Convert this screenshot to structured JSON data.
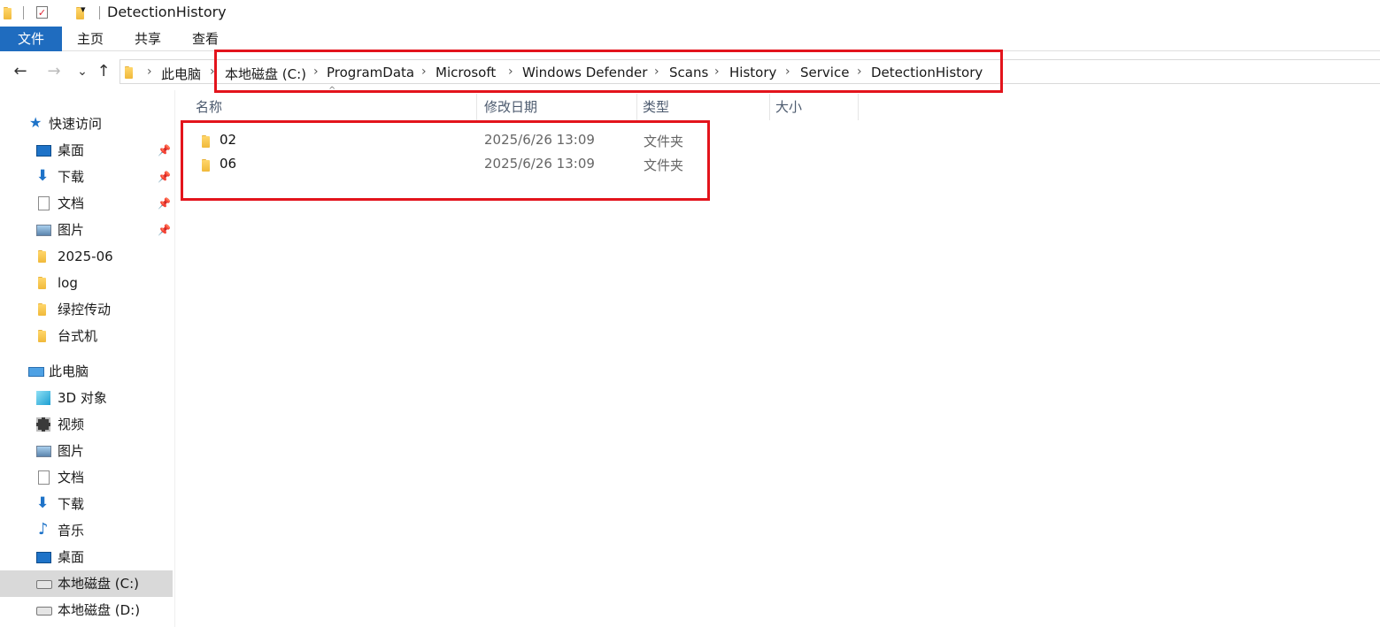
{
  "window": {
    "title": "DetectionHistory"
  },
  "ribbon": {
    "tabs": [
      "文件",
      "主页",
      "共享",
      "查看"
    ]
  },
  "nav": {
    "back": "←",
    "forward": "→",
    "recent": "⌄",
    "up": "↑"
  },
  "breadcrumb": [
    "此电脑",
    "本地磁盘 (C:)",
    "ProgramData",
    "Microsoft",
    "Windows Defender",
    "Scans",
    "History",
    "Service",
    "DetectionHistory"
  ],
  "sidebar": {
    "quick_access": "快速访问",
    "quick_items": [
      {
        "label": "桌面",
        "icon": "desktop-icon",
        "pinned": true
      },
      {
        "label": "下载",
        "icon": "download-icon",
        "pinned": true
      },
      {
        "label": "文档",
        "icon": "document-icon",
        "pinned": true
      },
      {
        "label": "图片",
        "icon": "picture-icon",
        "pinned": true
      },
      {
        "label": "2025-06",
        "icon": "folder-icon",
        "pinned": false
      },
      {
        "label": "log",
        "icon": "folder-icon",
        "pinned": false
      },
      {
        "label": "绿控传动",
        "icon": "folder-icon",
        "pinned": false
      },
      {
        "label": "台式机",
        "icon": "folder-icon",
        "pinned": false
      }
    ],
    "this_pc": "此电脑",
    "pc_items": [
      {
        "label": "3D 对象",
        "icon": "3d-objects-icon"
      },
      {
        "label": "视频",
        "icon": "video-icon"
      },
      {
        "label": "图片",
        "icon": "picture-icon"
      },
      {
        "label": "文档",
        "icon": "document-icon"
      },
      {
        "label": "下载",
        "icon": "download-icon"
      },
      {
        "label": "音乐",
        "icon": "music-icon"
      },
      {
        "label": "桌面",
        "icon": "desktop-icon"
      },
      {
        "label": "本地磁盘 (C:)",
        "icon": "drive-c-icon",
        "selected": true
      },
      {
        "label": "本地磁盘 (D:)",
        "icon": "drive-d-icon"
      }
    ]
  },
  "columns": [
    "名称",
    "修改日期",
    "类型",
    "大小"
  ],
  "files": [
    {
      "name": "02",
      "date": "2025/6/26 13:09",
      "type": "文件夹",
      "icon": "folder-icon"
    },
    {
      "name": "06",
      "date": "2025/6/26 13:09",
      "type": "文件夹",
      "icon": "folder-icon"
    }
  ],
  "colors": {
    "file_tab": "#1f6cbf",
    "highlight": "#e3141c",
    "selected_nav": "#d9d9d9"
  }
}
